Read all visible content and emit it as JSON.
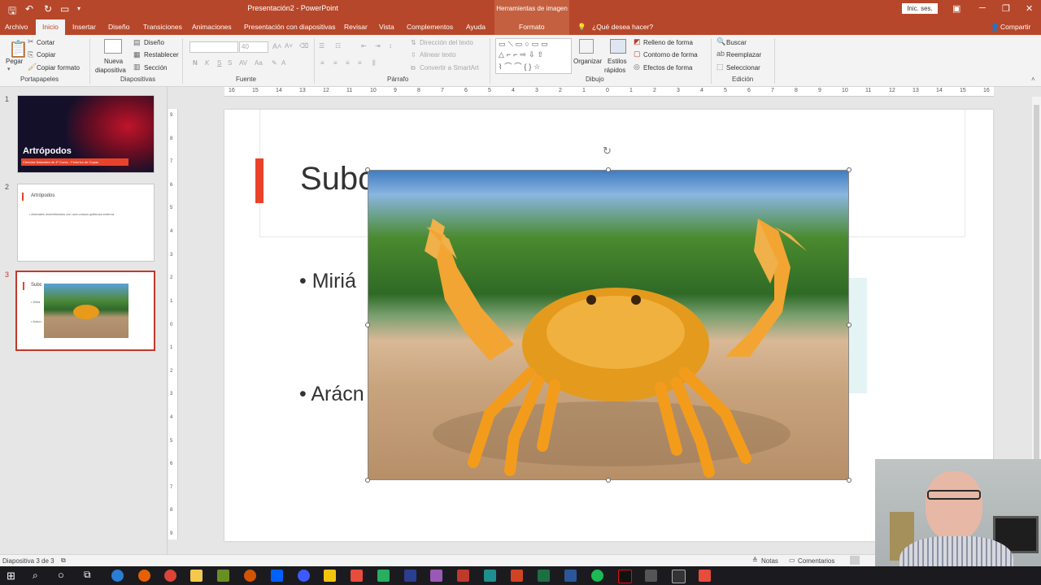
{
  "app": {
    "document_title": "Presentación2 - PowerPoint",
    "contextual_tab_title": "Herramientas de imagen",
    "signin_label": "Inic. ses."
  },
  "tabs": [
    {
      "label": "Archivo"
    },
    {
      "label": "Inicio",
      "active": true
    },
    {
      "label": "Insertar"
    },
    {
      "label": "Diseño"
    },
    {
      "label": "Transiciones"
    },
    {
      "label": "Animaciones"
    },
    {
      "label": "Presentación con diapositivas"
    },
    {
      "label": "Revisar"
    },
    {
      "label": "Vista"
    },
    {
      "label": "Complementos"
    },
    {
      "label": "Ayuda"
    },
    {
      "label": "Formato"
    }
  ],
  "tell_me": "¿Qué desea hacer?",
  "share_label": "Compartir",
  "ribbon": {
    "clipboard": {
      "paste": "Pegar",
      "cut": "Cortar",
      "copy": "Copiar",
      "format_painter": "Copiar formato",
      "label": "Portapapeles"
    },
    "slides": {
      "new_slide_1": "Nueva",
      "new_slide_2": "diapositiva",
      "layout": "Diseño",
      "reset": "Restablecer",
      "section": "Sección",
      "label": "Diapositivas"
    },
    "font": {
      "size": "40",
      "bold": "N",
      "italic": "K",
      "underline": "S",
      "strike": "S",
      "spacing": "AV",
      "case": "Aa",
      "label": "Fuente"
    },
    "paragraph": {
      "text_direction": "Dirección del texto",
      "align_text": "Alinear texto",
      "smartart": "Convertir a SmartArt",
      "label": "Párrafo"
    },
    "drawing": {
      "arrange": "Organizar",
      "quick_styles_1": "Estilos",
      "quick_styles_2": "rápidos",
      "shape_fill": "Relleno de forma",
      "shape_outline": "Contorno de forma",
      "shape_effects": "Efectos de forma",
      "label": "Dibujo"
    },
    "editing": {
      "find": "Buscar",
      "replace": "Reemplazar",
      "select": "Seleccionar",
      "label": "Edición"
    }
  },
  "ruler_ticks": [
    "16",
    "15",
    "14",
    "13",
    "12",
    "11",
    "10",
    "9",
    "8",
    "7",
    "6",
    "5",
    "4",
    "3",
    "2",
    "1",
    "0",
    "1",
    "2",
    "3",
    "4",
    "5",
    "6",
    "7",
    "8",
    "9",
    "10",
    "11",
    "12",
    "13",
    "14",
    "15",
    "16"
  ],
  "vruler_ticks": [
    "9",
    "8",
    "7",
    "6",
    "5",
    "4",
    "3",
    "2",
    "1",
    "0",
    "1",
    "2",
    "3",
    "4",
    "5",
    "6",
    "7",
    "8",
    "9"
  ],
  "thumbnails": [
    {
      "num": "1",
      "title": "Artrópodos",
      "subtitle": "Ciencias Naturales de 4º Curso - Federico de Copas"
    },
    {
      "num": "2",
      "title": "Artrópodos",
      "body": "• Animales invertebrados con una coraza quitinosa externa."
    },
    {
      "num": "3",
      "title": "Subc",
      "bullet1": "• Miria",
      "bullet2": "• Arácn"
    }
  ],
  "slide": {
    "title": "Subc",
    "bullet1": "• Miriá",
    "bullet2": "• Arácn"
  },
  "status": {
    "slide_info": "Diapositiva 3 de 3",
    "notes": "Notas",
    "comments": "Comentarios"
  },
  "colors": {
    "accent": "#b7472a",
    "slide_bar": "#e8432a"
  },
  "taskbar_icons": [
    "windows-start",
    "search",
    "cortana",
    "task-view",
    "edge",
    "firefox",
    "chrome",
    "file-explorer",
    "app",
    "app",
    "dropbox",
    "app",
    "app",
    "app",
    "app",
    "app",
    "app",
    "acrobat",
    "powerpoint-red",
    "powerpoint",
    "excel",
    "word",
    "spotify",
    "netflix",
    "calculator",
    "app",
    "app"
  ]
}
